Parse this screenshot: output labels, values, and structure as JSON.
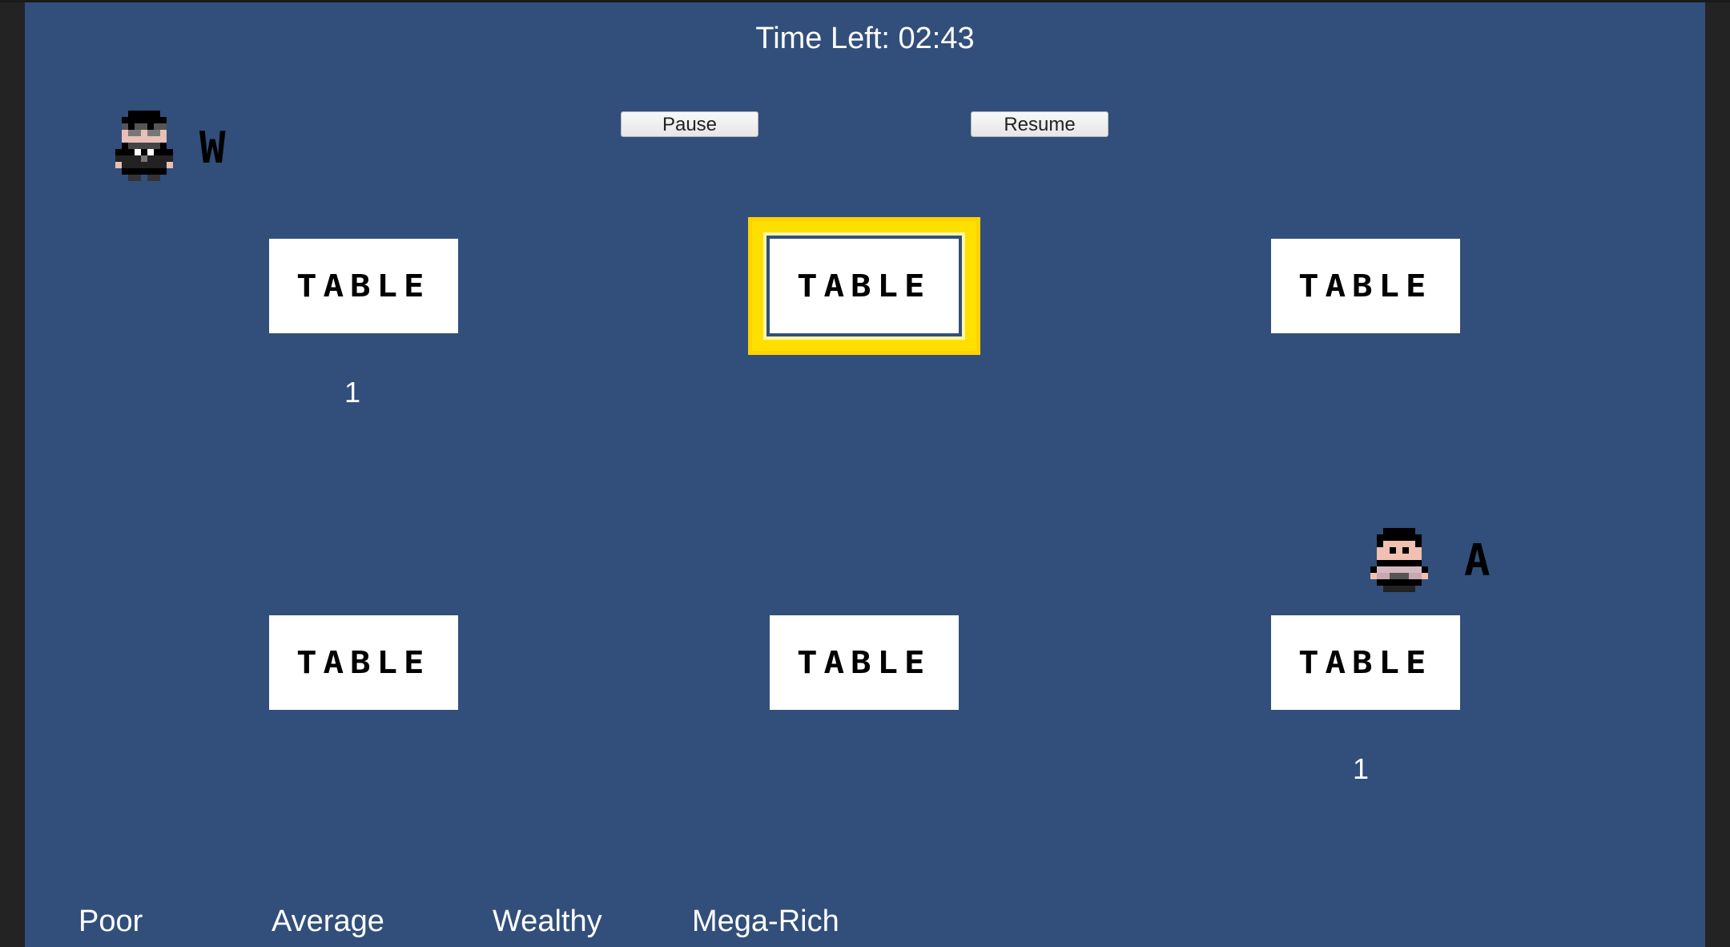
{
  "hud": {
    "timer_label": "Time Left: 02:43"
  },
  "controls": {
    "pause_label": "Pause",
    "resume_label": "Resume"
  },
  "tables": [
    {
      "label": "TABLE",
      "count": "1",
      "selected": false
    },
    {
      "label": "TABLE",
      "count": "",
      "selected": true
    },
    {
      "label": "TABLE",
      "count": "",
      "selected": false
    },
    {
      "label": "TABLE",
      "count": "",
      "selected": false
    },
    {
      "label": "TABLE",
      "count": "",
      "selected": false
    },
    {
      "label": "TABLE",
      "count": "1",
      "selected": false
    }
  ],
  "characters": [
    {
      "name": "waiter",
      "key": "W"
    },
    {
      "name": "customer",
      "key": "A"
    }
  ],
  "tiers": [
    "Poor",
    "Average",
    "Wealthy",
    "Mega-Rich"
  ],
  "colors": {
    "background": "#324f7b",
    "highlight": "#ffdf00",
    "table": "#ffffff"
  }
}
